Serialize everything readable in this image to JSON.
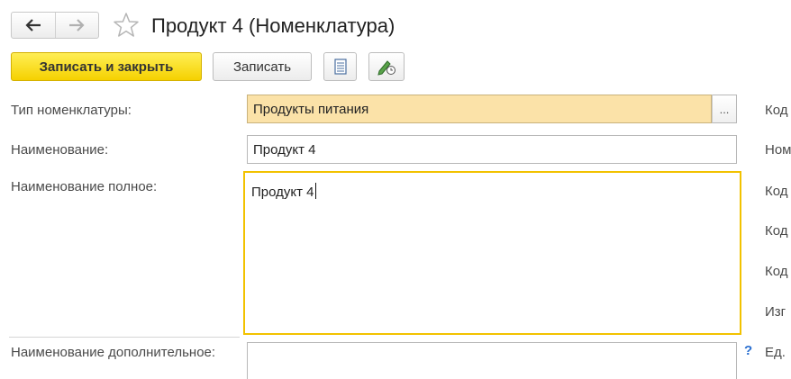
{
  "header": {
    "back_icon": "arrow-left-icon",
    "forward_icon": "arrow-right-icon",
    "favorite_icon": "star-icon",
    "title": "Продукт 4 (Номенклатура)"
  },
  "toolbar": {
    "save_close_label": "Записать и закрыть",
    "save_label": "Записать",
    "report_icon": "document-icon",
    "edit_icon": "pen-clock-icon"
  },
  "form": {
    "type": {
      "label": "Тип номенклатуры:",
      "value": "Продукты питания",
      "choose_label": "..."
    },
    "name": {
      "label": "Наименование:",
      "value": "Продукт 4"
    },
    "full_name": {
      "label": "Наименование полное:",
      "value": "Продукт 4"
    },
    "extra_name": {
      "label": "Наименование дополнительное:",
      "value": ""
    },
    "help_label": "?"
  },
  "right_column": [
    "Код",
    "Ном",
    "Код",
    "Код",
    "Код",
    "Изг",
    "Ед."
  ],
  "colors": {
    "accent": "#f5d100",
    "focus_border": "#f2c200",
    "select_bg": "#fbe2a8"
  }
}
